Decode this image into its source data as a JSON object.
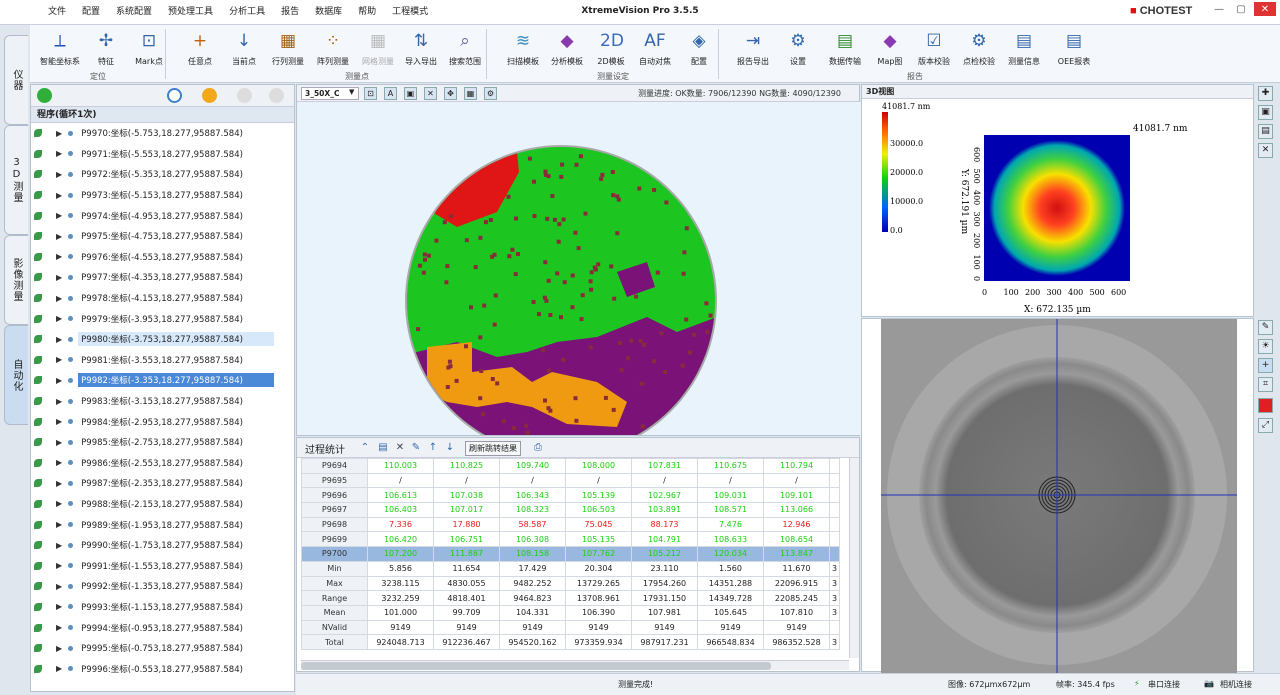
{
  "app": {
    "title": "XtremeVision Pro 3.5.5",
    "logo": "CHOTEST"
  },
  "menu": [
    "文件",
    "配置",
    "系统配置",
    "预处理工具",
    "分析工具",
    "报告",
    "数据库",
    "帮助",
    "工程模式"
  ],
  "side_tabs": [
    "仪器",
    "3D测量",
    "影像测量",
    "自动化"
  ],
  "ribbon": {
    "buttons": [
      {
        "label": "智能坐标系",
        "icon": "axis-icon"
      },
      {
        "label": "特征",
        "icon": "feature-icon"
      },
      {
        "label": "Mark点",
        "icon": "mark-point-icon"
      },
      {
        "label": "任意点",
        "icon": "any-point-icon"
      },
      {
        "label": "当前点",
        "icon": "current-point-icon"
      },
      {
        "label": "行列测量",
        "icon": "row-col-measure-icon"
      },
      {
        "label": "阵列测量",
        "icon": "array-measure-icon"
      },
      {
        "label": "网格测量",
        "icon": "grid-measure-icon"
      },
      {
        "label": "导入导出",
        "icon": "import-export-icon"
      },
      {
        "label": "搜索范围",
        "icon": "search-range-icon"
      },
      {
        "label": "扫描模板",
        "icon": "scan-template-icon"
      },
      {
        "label": "分析模板",
        "icon": "analysis-template-icon"
      },
      {
        "label": "2D模板",
        "icon": "2d-template-icon"
      },
      {
        "label": "自动对焦",
        "icon": "autofocus-icon"
      },
      {
        "label": "配置",
        "icon": "config-icon"
      },
      {
        "label": "报告导出",
        "icon": "report-export-icon"
      },
      {
        "label": "设置",
        "icon": "settings-icon"
      },
      {
        "label": "数据传输",
        "icon": "data-transfer-icon"
      },
      {
        "label": "Map图",
        "icon": "map-icon"
      },
      {
        "label": "版本校验",
        "icon": "version-check-icon"
      },
      {
        "label": "点检校验",
        "icon": "spot-check-icon"
      },
      {
        "label": "测量信息",
        "icon": "measure-info-icon"
      },
      {
        "label": "OEE报表",
        "icon": "oee-report-icon"
      }
    ],
    "groups": [
      "定位",
      "测量点",
      "测量设定",
      "报告"
    ]
  },
  "program": {
    "title": "程序(循环1次)",
    "items": [
      "P9970:坐标(-5.753,18.277,95887.584)",
      "P9971:坐标(-5.553,18.277,95887.584)",
      "P9972:坐标(-5.353,18.277,95887.584)",
      "P9973:坐标(-5.153,18.277,95887.584)",
      "P9974:坐标(-4.953,18.277,95887.584)",
      "P9975:坐标(-4.753,18.277,95887.584)",
      "P9976:坐标(-4.553,18.277,95887.584)",
      "P9977:坐标(-4.353,18.277,95887.584)",
      "P9978:坐标(-4.153,18.277,95887.584)",
      "P9979:坐标(-3.953,18.277,95887.584)",
      "P9980:坐标(-3.753,18.277,95887.584)",
      "P9981:坐标(-3.553,18.277,95887.584)",
      "P9982:坐标(-3.353,18.277,95887.584)",
      "P9983:坐标(-3.153,18.277,95887.584)",
      "P9984:坐标(-2.953,18.277,95887.584)",
      "P9985:坐标(-2.753,18.277,95887.584)",
      "P9986:坐标(-2.553,18.277,95887.584)",
      "P9987:坐标(-2.353,18.277,95887.584)",
      "P9988:坐标(-2.153,18.277,95887.584)",
      "P9989:坐标(-1.953,18.277,95887.584)",
      "P9990:坐标(-1.753,18.277,95887.584)",
      "P9991:坐标(-1.553,18.277,95887.584)",
      "P9992:坐标(-1.353,18.277,95887.584)",
      "P9993:坐标(-1.153,18.277,95887.584)",
      "P9994:坐标(-0.953,18.277,95887.584)",
      "P9995:坐标(-0.753,18.277,95887.584)",
      "P9996:坐标(-0.553,18.277,95887.584)"
    ]
  },
  "map": {
    "lens": "3_50X_C",
    "progress": "测量进度: OK数量: 7906/12390  NG数量: 4090/12390"
  },
  "stats": {
    "title": "过程统计",
    "refresh": "刷新跳转结果",
    "rows": [
      {
        "h": "P9694",
        "c": "g",
        "v": [
          "110.003",
          "110.825",
          "109.740",
          "108.000",
          "107.831",
          "110.675",
          "110.794"
        ]
      },
      {
        "h": "P9695",
        "c": "",
        "v": [
          "/",
          "/",
          "/",
          "/",
          "/",
          "/",
          "/"
        ]
      },
      {
        "h": "P9696",
        "c": "g",
        "v": [
          "106.613",
          "107.038",
          "106.343",
          "105.139",
          "102.967",
          "109.031",
          "109.101"
        ]
      },
      {
        "h": "P9697",
        "c": "g",
        "v": [
          "106.403",
          "107.017",
          "108.323",
          "106.503",
          "103.891",
          "108.571",
          "113.066"
        ]
      },
      {
        "h": "P9698",
        "c": "r",
        "v": [
          "7.336",
          "17.880",
          "58.587",
          "75.045",
          "88.173",
          "7.476",
          "12.946"
        ]
      },
      {
        "h": "P9699",
        "c": "g",
        "v": [
          "106.420",
          "106.751",
          "106.308",
          "105.135",
          "104.791",
          "108.633",
          "108.654"
        ]
      },
      {
        "h": "P9700",
        "c": "g",
        "sel": true,
        "v": [
          "107.200",
          "111.887",
          "108.158",
          "107.762",
          "105.212",
          "120.034",
          "113.847"
        ]
      },
      {
        "h": "Min",
        "c": "",
        "v": [
          "5.856",
          "11.654",
          "17.429",
          "20.304",
          "23.110",
          "1.560",
          "11.670"
        ]
      },
      {
        "h": "Max",
        "c": "",
        "v": [
          "3238.115",
          "4830.055",
          "9482.252",
          "13729.265",
          "17954.260",
          "14351.288",
          "22096.915"
        ]
      },
      {
        "h": "Range",
        "c": "",
        "v": [
          "3232.259",
          "4818.401",
          "9464.823",
          "13708.961",
          "17931.150",
          "14349.728",
          "22085.245"
        ]
      },
      {
        "h": "Mean",
        "c": "",
        "v": [
          "101.000",
          "99.709",
          "104.331",
          "106.390",
          "107.981",
          "105.645",
          "107.810"
        ]
      },
      {
        "h": "NValid",
        "c": "",
        "v": [
          "9149",
          "9149",
          "9149",
          "9149",
          "9149",
          "9149",
          "9149"
        ]
      },
      {
        "h": "Total",
        "c": "",
        "v": [
          "924048.713",
          "912236.467",
          "954520.162",
          "973359.934",
          "987917.231",
          "966548.834",
          "986352.528"
        ]
      }
    ]
  },
  "view3d": {
    "title": "3D视图",
    "cbar_max": "41081.7 nm",
    "cbar_ticks": [
      "30000.0",
      "20000.0",
      "10000.0",
      "0.0"
    ],
    "peak": "41081.7 nm",
    "xlabel": "X: 672.135 µm",
    "ylabel": "Y: 672.191 µm",
    "xticks": [
      "0",
      "100",
      "200",
      "300",
      "400",
      "500",
      "600"
    ],
    "yticks": [
      "600",
      "500",
      "400",
      "300",
      "200",
      "100",
      "0"
    ]
  },
  "status": {
    "msg": "测量完成!",
    "image": "图像: 672µmx672µm",
    "fps": "帧率: 345.4 fps",
    "serial": "串口连接",
    "camera": "相机连接"
  },
  "colors": {
    "ok": "#1ad10f",
    "ng": "#ee1a1a",
    "selected": "#4a88d8"
  }
}
